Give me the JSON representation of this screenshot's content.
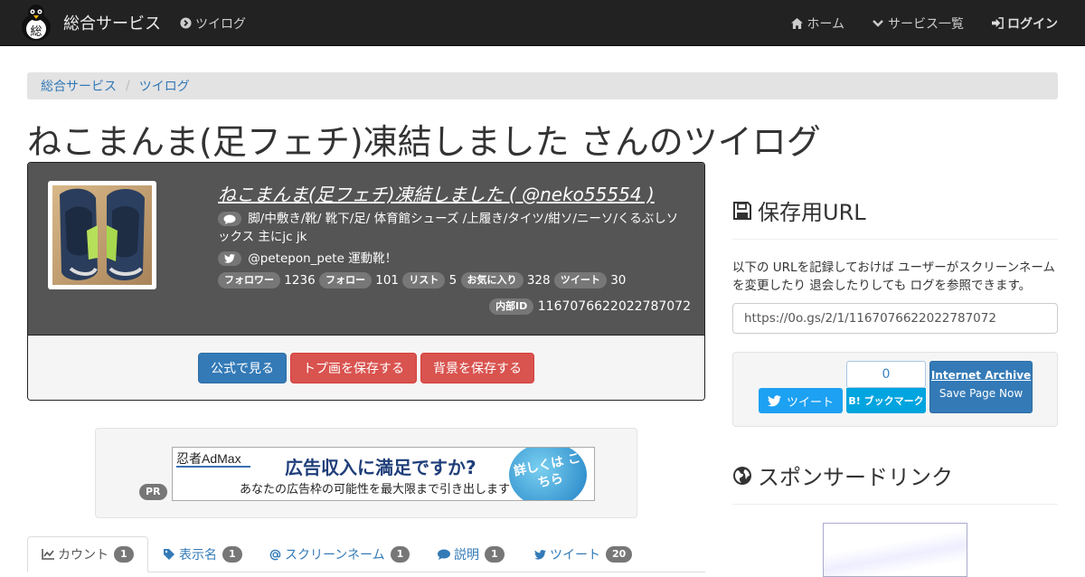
{
  "navbar": {
    "brand": "総合サービス",
    "brand_logo_char": "総",
    "left_link": "ツイログ",
    "right_links": [
      "ホーム",
      "サービス一覧",
      "ログイン"
    ]
  },
  "breadcrumb": [
    "総合サービス",
    "ツイログ"
  ],
  "page_title": "ねこまんま(足フェチ)凍結しました さんのツイログ",
  "profile": {
    "name_line": "ねこまんま(足フェチ)凍結しました ( @neko55554 )",
    "description": "脚/中敷き/靴/ 靴下/足/ 体育館シューズ /上履き/タイツ/紺ソ/ニーソ/くるぶしソックス 主にjc jk",
    "link_text": "@petepon_pete 運動靴！",
    "stats": [
      {
        "label": "フォロワー",
        "value": "1236"
      },
      {
        "label": "フォロー",
        "value": "101"
      },
      {
        "label": "リスト",
        "value": "5"
      },
      {
        "label": "お気に入り",
        "value": "328"
      },
      {
        "label": "ツイート",
        "value": "30"
      }
    ],
    "internal_id_label": "内部ID",
    "internal_id": "1167076622022787072",
    "buttons": {
      "official": "公式で見る",
      "save_avatar": "トプ画を保存する",
      "save_bg": "背景を保存する"
    }
  },
  "ad": {
    "pr_label": "PR",
    "brand": "忍者AdMax",
    "headline": "広告収入に満足ですか?",
    "subline": "あなたの広告枠の可能性を最大限まで引き出します",
    "circle_text": "詳しくは こちら"
  },
  "tabs": [
    {
      "label": "カウント",
      "count": "1"
    },
    {
      "label": "表示名",
      "count": "1"
    },
    {
      "label": "スクリーンネーム",
      "count": "1"
    },
    {
      "label": "説明",
      "count": "1"
    },
    {
      "label": "ツイート",
      "count": "20"
    }
  ],
  "sidebar": {
    "save_url_title": "保存用URL",
    "save_url_text": "以下の URLを記録しておけば ユーザーがスクリーンネームを変更したり 退会したりしても ログを参照できます。",
    "save_url_value": "https://0o.gs/2/1/1167076622022787072",
    "tweet_button": "ツイート",
    "hatena_count": "0",
    "hatena_button": "B! ブックマーク",
    "ia_line1": "Internet Archive",
    "ia_line2": "Save Page Now",
    "sponsor_title": "スポンサードリンク"
  },
  "colors": {
    "navbar": "#222222",
    "primary": "#337ab7",
    "danger": "#d9534f",
    "twitter": "#1da1f2",
    "hatena": "#00a4de"
  }
}
